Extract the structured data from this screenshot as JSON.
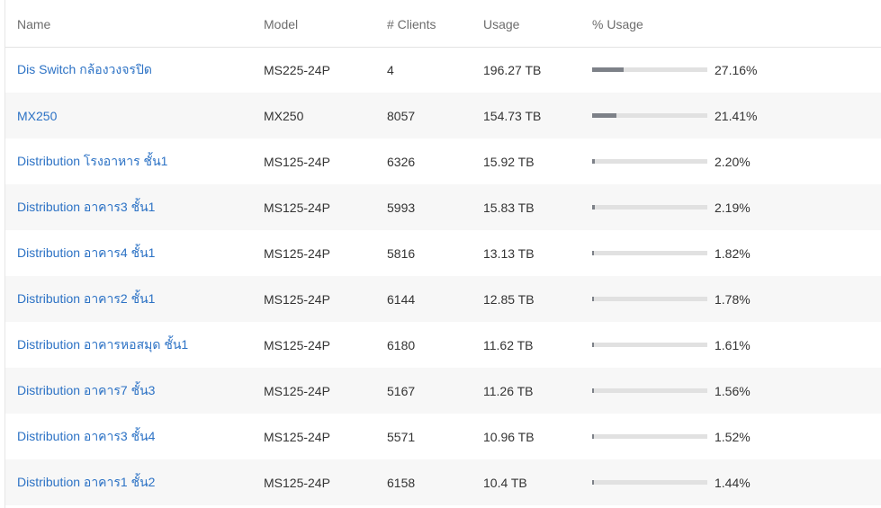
{
  "table": {
    "headers": {
      "name": "Name",
      "model": "Model",
      "clients": "# Clients",
      "usage": "Usage",
      "pct_usage": "% Usage"
    },
    "rows": [
      {
        "name": "Dis Switch กล้องวงจรปิด",
        "model": "MS225-24P",
        "clients": "4",
        "usage": "196.27 TB",
        "pct_label": "27.16%",
        "pct": 27.16
      },
      {
        "name": "MX250",
        "model": "MX250",
        "clients": "8057",
        "usage": "154.73 TB",
        "pct_label": "21.41%",
        "pct": 21.41
      },
      {
        "name": "Distribution โรงอาหาร ชั้น1",
        "model": "MS125-24P",
        "clients": "6326",
        "usage": "15.92 TB",
        "pct_label": "2.20%",
        "pct": 2.2
      },
      {
        "name": "Distribution อาคาร3 ชั้น1",
        "model": "MS125-24P",
        "clients": "5993",
        "usage": "15.83 TB",
        "pct_label": "2.19%",
        "pct": 2.19
      },
      {
        "name": "Distribution อาคาร4 ชั้น1",
        "model": "MS125-24P",
        "clients": "5816",
        "usage": "13.13 TB",
        "pct_label": "1.82%",
        "pct": 1.82
      },
      {
        "name": "Distribution อาคาร2 ชั้น1",
        "model": "MS125-24P",
        "clients": "6144",
        "usage": "12.85 TB",
        "pct_label": "1.78%",
        "pct": 1.78
      },
      {
        "name": "Distribution อาคารหอสมุด ชั้น1",
        "model": "MS125-24P",
        "clients": "6180",
        "usage": "11.62 TB",
        "pct_label": "1.61%",
        "pct": 1.61
      },
      {
        "name": "Distribution อาคาร7 ชั้น3",
        "model": "MS125-24P",
        "clients": "5167",
        "usage": "11.26 TB",
        "pct_label": "1.56%",
        "pct": 1.56
      },
      {
        "name": "Distribution อาคาร3 ชั้น4",
        "model": "MS125-24P",
        "clients": "5571",
        "usage": "10.96 TB",
        "pct_label": "1.52%",
        "pct": 1.52
      },
      {
        "name": "Distribution อาคาร1 ชั้น2",
        "model": "MS125-24P",
        "clients": "6158",
        "usage": "10.4 TB",
        "pct_label": "1.44%",
        "pct": 1.44
      }
    ]
  },
  "colors": {
    "link": "#2c72c5",
    "bar_fill": "#7d8188",
    "bar_track": "#e1e1e1",
    "row_alt": "#f7f7f7"
  }
}
